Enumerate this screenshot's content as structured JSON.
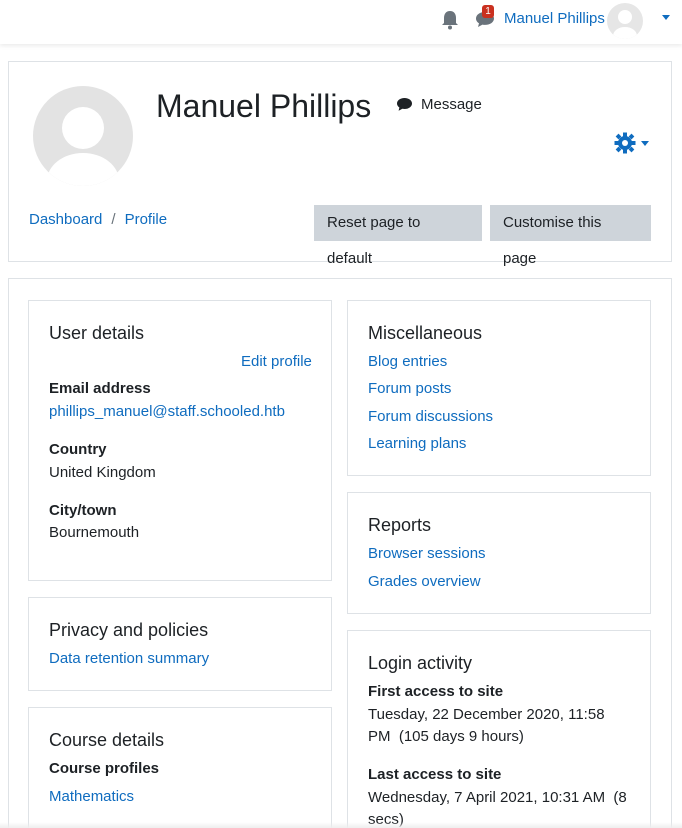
{
  "navbar": {
    "notification_count": "1",
    "user_name": "Manuel Phillips"
  },
  "header": {
    "name": "Manuel Phillips",
    "message_label": "Message",
    "breadcrumb": [
      "Dashboard",
      "Profile"
    ],
    "breadcrumb_separator": "/",
    "reset_button": "Reset page to default",
    "customise_button": "Customise this page"
  },
  "user_details": {
    "title": "User details",
    "edit_profile": "Edit profile",
    "email_label": "Email address",
    "email_value": "phillips_manuel@staff.schooled.htb",
    "country_label": "Country",
    "country_value": "United Kingdom",
    "city_label": "City/town",
    "city_value": "Bournemouth"
  },
  "privacy": {
    "title": "Privacy and policies",
    "link": "Data retention summary"
  },
  "course_details": {
    "title": "Course details",
    "profiles_label": "Course profiles",
    "course": "Mathematics"
  },
  "miscellaneous": {
    "title": "Miscellaneous",
    "links": [
      "Blog entries",
      "Forum posts",
      "Forum discussions",
      "Learning plans"
    ]
  },
  "reports": {
    "title": "Reports",
    "links": [
      "Browser sessions",
      "Grades overview"
    ]
  },
  "login_activity": {
    "title": "Login activity",
    "first_label": "First access to site",
    "first_value": "Tuesday, 22 December 2020, 11:58 PM  (105 days 9 hours)",
    "last_label": "Last access to site",
    "last_value": "Wednesday, 7 April 2021, 10:31 AM  (8 secs)"
  },
  "colors": {
    "link": "#0f6cbf",
    "button_bg": "#ced4da",
    "badge": "#ca3120",
    "border": "#dee2e6"
  },
  "icons": [
    "bell-icon",
    "chat-icon",
    "user-avatar",
    "comment-icon",
    "gear-icon",
    "caret-down-icon"
  ]
}
